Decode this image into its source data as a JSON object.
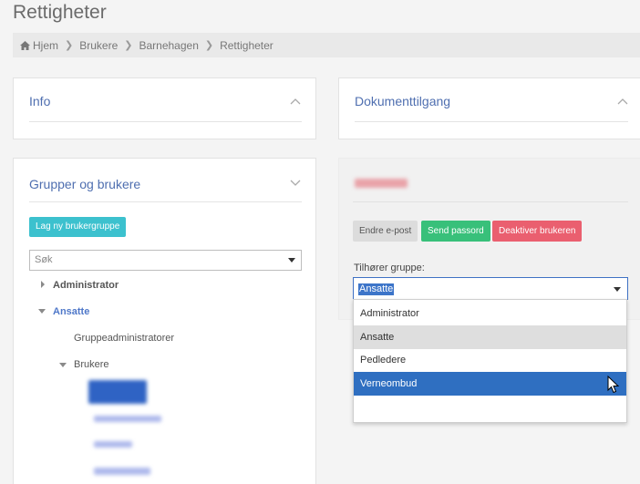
{
  "page": {
    "title": "Rettigheter"
  },
  "breadcrumb": {
    "home": "Hjem",
    "items": [
      "Brukere",
      "Barnehagen",
      "Rettigheter"
    ]
  },
  "panels": {
    "info": {
      "title": "Info"
    },
    "dokument": {
      "title": "Dokumenttilgang"
    },
    "groups": {
      "title": "Grupper og brukere",
      "new_group_button": "Lag ny brukergruppe",
      "search_placeholder": "Søk",
      "tree": {
        "administrator": "Administrator",
        "ansatte": "Ansatte",
        "gruppeadmin": "Gruppeadministratorer",
        "brukere": "Brukere"
      }
    }
  },
  "user": {
    "buttons": {
      "change_email": "Endre e-post",
      "send_password": "Send passord",
      "deactivate": "Deaktiver brukeren"
    },
    "group_label": "Tilhører gruppe:",
    "group_value": "Ansatte",
    "options": [
      "Administrator",
      "Ansatte",
      "Pedledere",
      "Verneombud"
    ]
  },
  "colors": {
    "accent": "#4f6fb0",
    "teal": "#3cc1ce",
    "green": "#38c07a",
    "red": "#ea5f6f",
    "selected": "#2f6fc1"
  }
}
